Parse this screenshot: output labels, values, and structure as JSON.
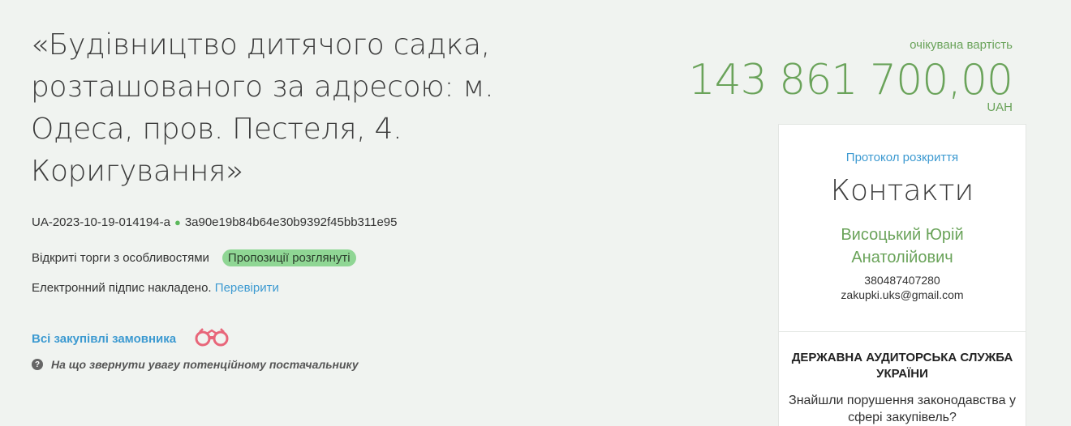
{
  "tender": {
    "title": "«Будівництво дитячого садка, розташованого за адресою: м. Одеса, пров. Пестеля, 4. Коригування»",
    "id": "UA-2023-10-19-014194-a",
    "dot": "●",
    "hash": "3a90e19b84b64e30b9392f45bb311e95",
    "procedure_type": "Відкриті торги з особливостями",
    "status": "Пропозиції розглянуті",
    "signature_text": "Електронний підпис накладено.",
    "verify_link": "Перевірити",
    "buyer_tenders_link": "Всі закупівлі замовника",
    "hint_icon": "?",
    "hint": "На що звернути увагу потенційному постачальнику"
  },
  "price": {
    "label": "очікувана вартість",
    "value": "143 861 700,00",
    "currency": "UAH"
  },
  "contacts_card": {
    "protocol_link": "Протокол розкриття",
    "heading": "Контакти",
    "person": "Висоцький Юрій Анатолійович",
    "phone": "380487407280",
    "email": "zakupki.uks@gmail.com"
  },
  "audit_card": {
    "title": "ДЕРЖАВНА АУДИТОРСЬКА СЛУЖБА УКРАЇНИ",
    "text": "Знайшли порушення законодавства у сфері закупівель?"
  },
  "colors": {
    "accent_green": "#6aa35a",
    "link_blue": "#3d9ad1",
    "badge_green": "#8fd694",
    "binoculars_red": "#e8667a"
  }
}
